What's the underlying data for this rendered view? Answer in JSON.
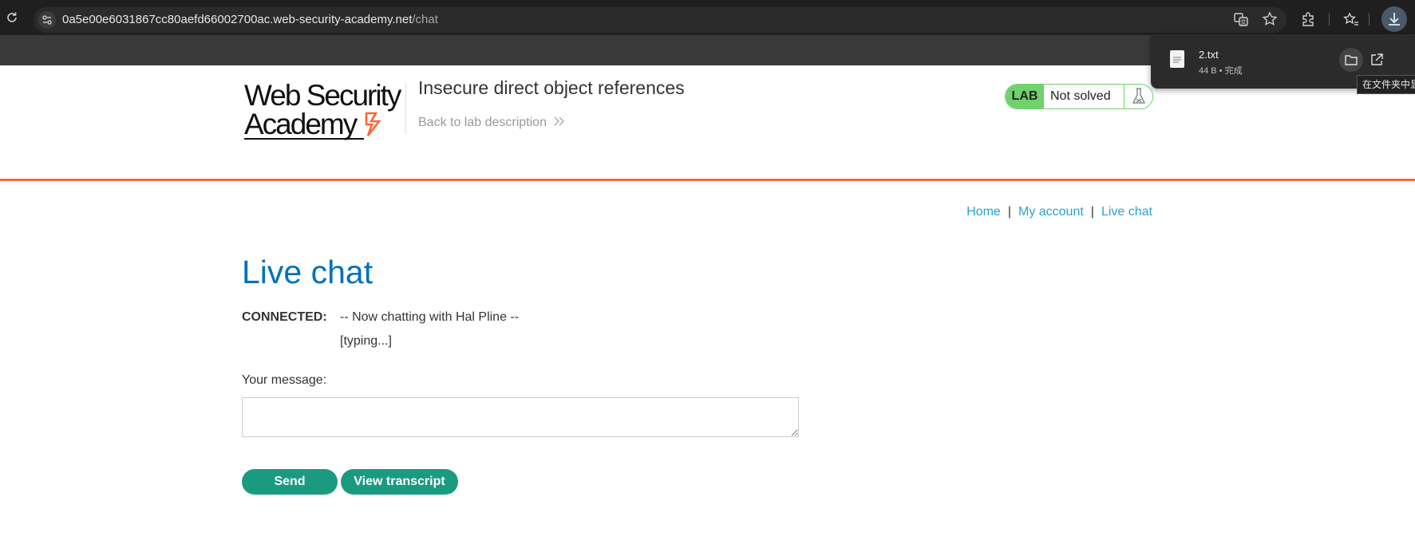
{
  "browser": {
    "url_host": "0a5e00e6031867cc80aefd66002700ac.web-security-academy.net",
    "url_path": "/chat",
    "download": {
      "filename": "2.txt",
      "meta": "44 B • 完成",
      "tooltip": "在文件夹中显"
    }
  },
  "header": {
    "logo_line1": "Web Security",
    "logo_line2": "Academy",
    "lab_title": "Insecure direct object references",
    "back_link": "Back to lab description",
    "badge": {
      "label": "LAB",
      "status": "Not solved"
    }
  },
  "nav": {
    "home": "Home",
    "my_account": "My account",
    "live_chat": "Live chat",
    "separator": "|"
  },
  "main": {
    "title": "Live chat",
    "chat": {
      "label": "CONNECTED:",
      "message": "-- Now chatting with Hal Pline --",
      "typing": "[typing...]"
    },
    "message_label": "Your message:",
    "message_value": "",
    "send_label": "Send",
    "transcript_label": "View transcript"
  },
  "colors": {
    "accent_orange": "#ff6633",
    "title_blue": "#0071bc",
    "link_blue": "#29a3d3",
    "button_green": "#1a9b7f",
    "badge_green": "#70d16d"
  }
}
